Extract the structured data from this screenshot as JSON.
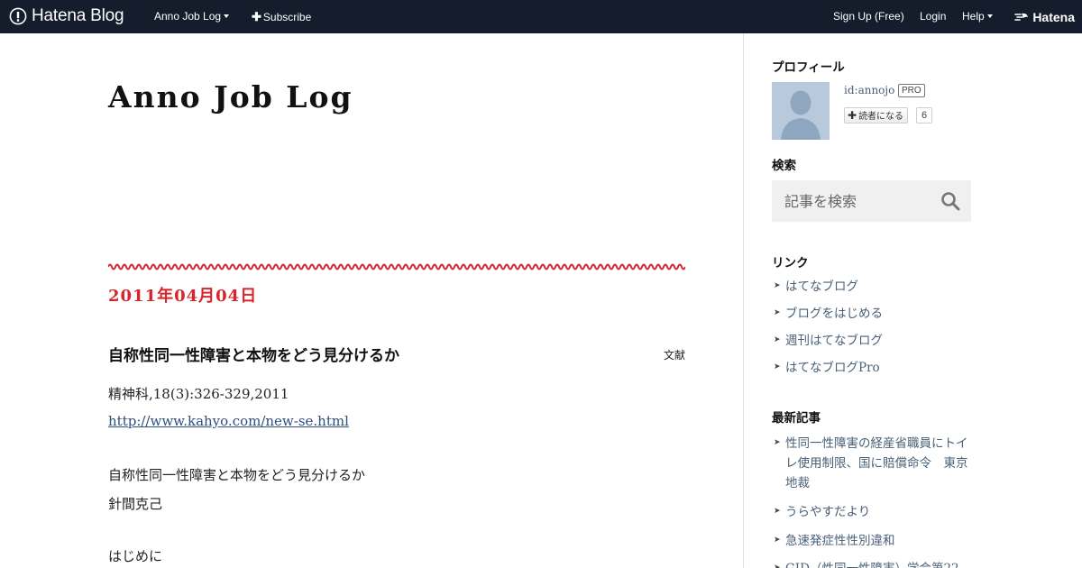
{
  "topbar": {
    "logo_text": "Hatena Blog",
    "blog_menu": "Anno Job Log",
    "subscribe": "Subscribe",
    "signup": "Sign Up (Free)",
    "login": "Login",
    "help": "Help",
    "brand": "Hatena",
    "bg_color": "#151c2c"
  },
  "blog": {
    "title": "Anno Job Log"
  },
  "entry": {
    "date": "2011年04月04日",
    "title": "自称性同一性障害と本物をどう見分けるか",
    "category": "文献",
    "citation": "精神科,18(3):326-329,2011",
    "url": "http://www.kahyo.com/new-se.html",
    "body_title": "自称性同一性障害と本物をどう見分けるか",
    "author": "針間克己",
    "section": "はじめに"
  },
  "sidebar": {
    "profile": {
      "heading": "プロフィール",
      "user_id": "id:annojo",
      "badge": "PRO",
      "follow_label": "読者になる",
      "follower_count": "6"
    },
    "search": {
      "heading": "検索",
      "placeholder": "記事を検索"
    },
    "links": {
      "heading": "リンク",
      "items": [
        "はてなブログ",
        "ブログをはじめる",
        "週刊はてなブログ",
        "はてなブログPro"
      ]
    },
    "recent": {
      "heading": "最新記事",
      "items": [
        "性同一性障害の経産省職員にトイレ使用制限、国に賠償命令　東京地裁",
        "うらやすだより",
        "急速発症性性別違和",
        "GID（性同一性障害）学会第22"
      ]
    }
  },
  "colors": {
    "date_red": "#d7262b",
    "link": "#4a6078"
  }
}
